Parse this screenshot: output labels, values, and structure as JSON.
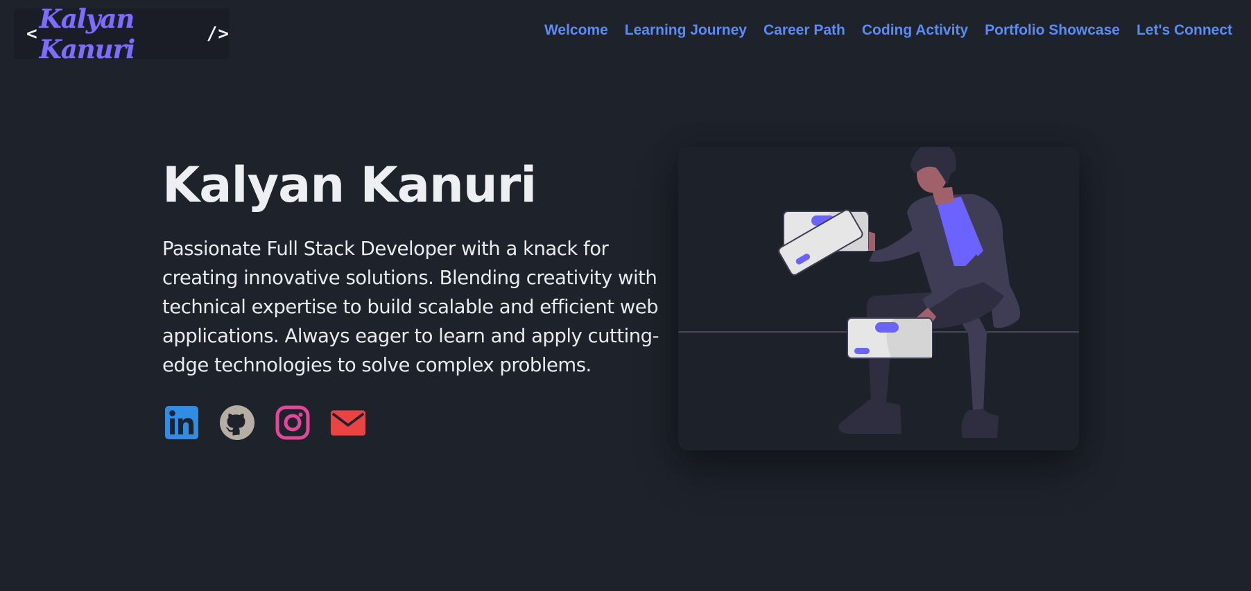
{
  "header": {
    "logo": {
      "open": "<",
      "name": "Kalyan Kanuri",
      "close": "/>"
    },
    "nav": [
      {
        "label": "Welcome"
      },
      {
        "label": "Learning Journey"
      },
      {
        "label": "Career Path"
      },
      {
        "label": "Coding Activity"
      },
      {
        "label": "Portfolio Showcase"
      },
      {
        "label": "Let's Connect"
      }
    ]
  },
  "hero": {
    "title": "Kalyan Kanuri",
    "description": "Passionate Full Stack Developer with a knack for creating innovative solutions. Blending creativity with technical expertise to build scalable and efficient web applications. Always eager to learn and apply cutting-edge technologies to solve complex problems."
  },
  "socials": [
    {
      "icon": "linkedin-icon",
      "color": "#2f8de4"
    },
    {
      "icon": "github-icon",
      "color": "#b6aea4"
    },
    {
      "icon": "instagram-icon",
      "color": "#e1489a"
    },
    {
      "icon": "email-icon",
      "color": "#ea4343"
    }
  ],
  "colors": {
    "background": "#1e222b",
    "nav_link": "#5b8cf5",
    "accent": "#6c63ff"
  }
}
